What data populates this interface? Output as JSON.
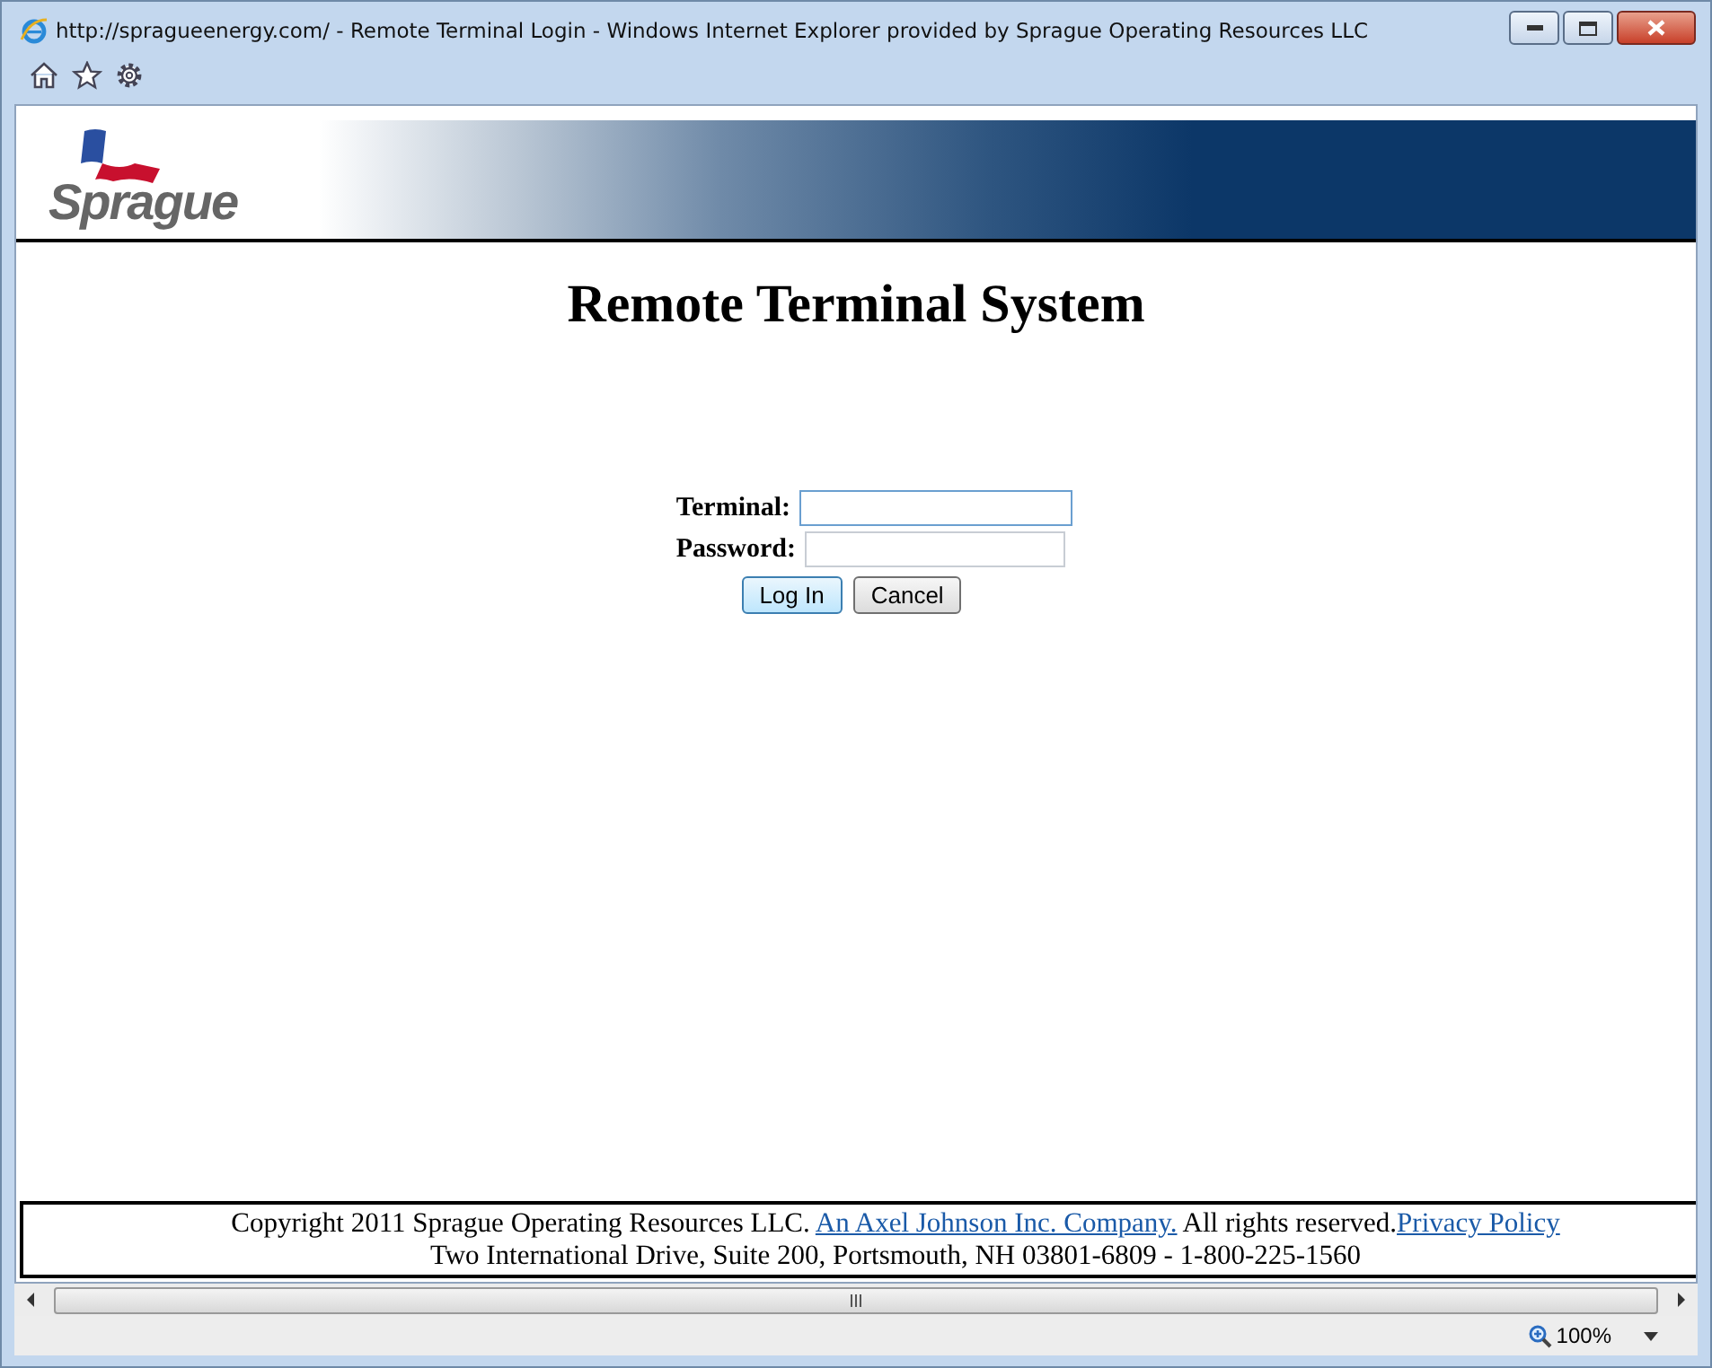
{
  "window": {
    "title": "http://spragueenergy.com/ - Remote Terminal Login - Windows Internet Explorer provided by Sprague Operating Resources LLC"
  },
  "logo": {
    "text": "Sprague"
  },
  "heading": "Remote Terminal System",
  "fields": [
    {
      "label": "Terminal:",
      "focused": true
    },
    {
      "label": "Password:",
      "focused": false
    }
  ],
  "buttons": [
    {
      "label": "Log In",
      "focused": true
    },
    {
      "label": "Cancel",
      "focused": false
    }
  ],
  "footer": {
    "copyright": "Copyright 2011 Sprague Operating Resources LLC. ",
    "company_link": "An Axel Johnson Inc. Company.",
    "rights": " All rights reserved.",
    "privacy_link": "Privacy Policy",
    "address": "Two International Drive, Suite 200, Portsmouth, NH 03801-6809 - 1-800-225-1560"
  },
  "status_bar": {
    "zoom": "100%"
  }
}
